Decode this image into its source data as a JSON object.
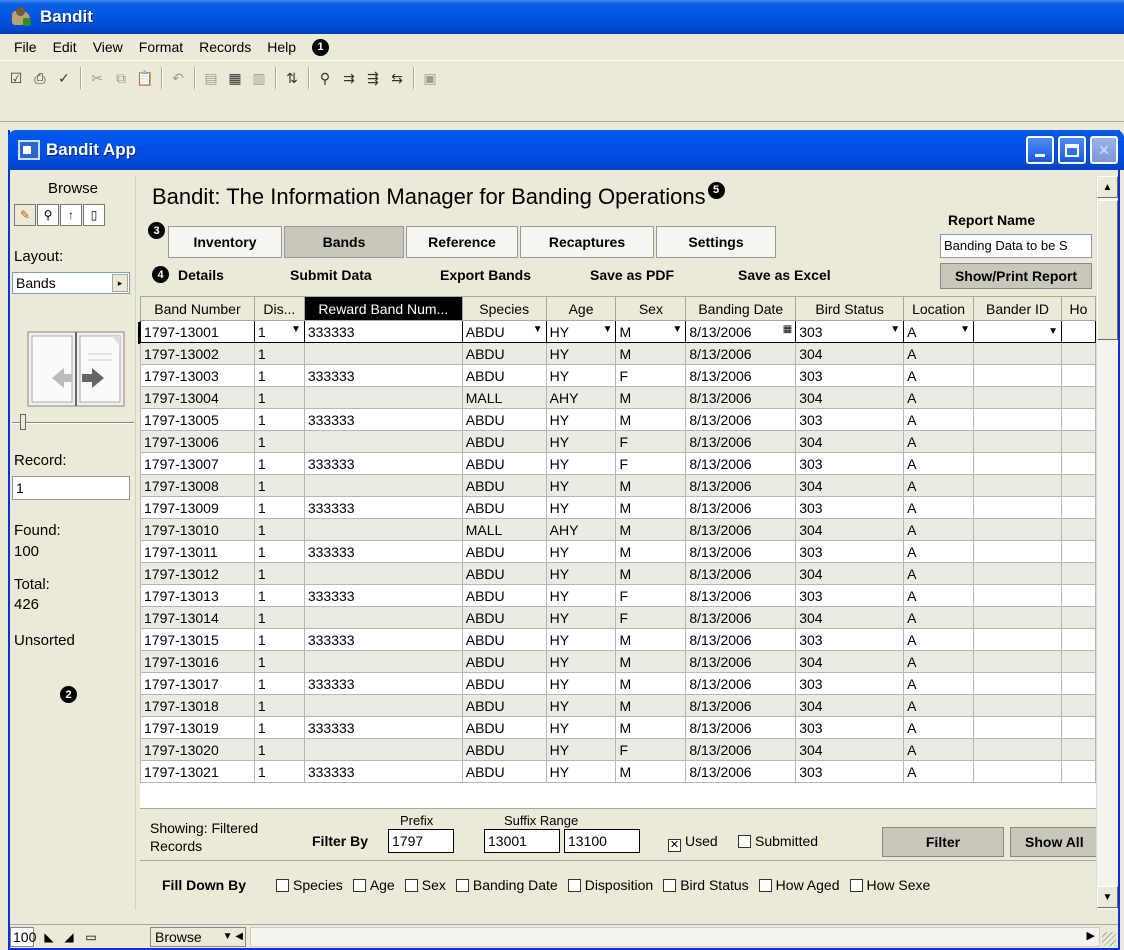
{
  "window": {
    "title": "Bandit",
    "inner_title": "Bandit App"
  },
  "menu": [
    "File",
    "Edit",
    "View",
    "Format",
    "Records",
    "Help"
  ],
  "markers": {
    "m1": "1",
    "m2": "2",
    "m3": "3",
    "m4": "4",
    "m5": "5"
  },
  "sidebar": {
    "mode_label": "Browse",
    "layout_label": "Layout:",
    "layout_value": "Bands",
    "record_label": "Record:",
    "record_value": "1",
    "found_label": "Found:",
    "found_value": "100",
    "total_label": "Total:",
    "total_value": "426",
    "sort_status": "Unsorted"
  },
  "header": {
    "title": "Bandit: The Information Manager for Banding Operations",
    "report_label": "Report Name",
    "report_value": "Banding Data to be S",
    "show_print": "Show/Print Report"
  },
  "tabs": [
    {
      "label": "Inventory"
    },
    {
      "label": "Bands"
    },
    {
      "label": "Reference"
    },
    {
      "label": "Recaptures"
    },
    {
      "label": "Settings"
    }
  ],
  "actions": [
    "Details",
    "Submit Data",
    "Export Bands",
    "Save as PDF",
    "Save as Excel"
  ],
  "columns": [
    "Band Number",
    "Dis...",
    "Reward Band Num...",
    "Species",
    "Age",
    "Sex",
    "Banding Date",
    "Bird Status",
    "Location",
    "Bander ID",
    "Ho"
  ],
  "rows": [
    [
      "1797-13001",
      "1",
      "333333",
      "ABDU",
      "HY",
      "M",
      "8/13/2006",
      "303",
      "A",
      "",
      ""
    ],
    [
      "1797-13002",
      "1",
      "",
      "ABDU",
      "HY",
      "M",
      "8/13/2006",
      "304",
      "A",
      "",
      ""
    ],
    [
      "1797-13003",
      "1",
      "333333",
      "ABDU",
      "HY",
      "F",
      "8/13/2006",
      "303",
      "A",
      "",
      ""
    ],
    [
      "1797-13004",
      "1",
      "",
      "MALL",
      "AHY",
      "M",
      "8/13/2006",
      "304",
      "A",
      "",
      ""
    ],
    [
      "1797-13005",
      "1",
      "333333",
      "ABDU",
      "HY",
      "M",
      "8/13/2006",
      "303",
      "A",
      "",
      ""
    ],
    [
      "1797-13006",
      "1",
      "",
      "ABDU",
      "HY",
      "F",
      "8/13/2006",
      "304",
      "A",
      "",
      ""
    ],
    [
      "1797-13007",
      "1",
      "333333",
      "ABDU",
      "HY",
      "F",
      "8/13/2006",
      "303",
      "A",
      "",
      ""
    ],
    [
      "1797-13008",
      "1",
      "",
      "ABDU",
      "HY",
      "M",
      "8/13/2006",
      "304",
      "A",
      "",
      ""
    ],
    [
      "1797-13009",
      "1",
      "333333",
      "ABDU",
      "HY",
      "M",
      "8/13/2006",
      "303",
      "A",
      "",
      ""
    ],
    [
      "1797-13010",
      "1",
      "",
      "MALL",
      "AHY",
      "M",
      "8/13/2006",
      "304",
      "A",
      "",
      ""
    ],
    [
      "1797-13011",
      "1",
      "333333",
      "ABDU",
      "HY",
      "M",
      "8/13/2006",
      "303",
      "A",
      "",
      ""
    ],
    [
      "1797-13012",
      "1",
      "",
      "ABDU",
      "HY",
      "M",
      "8/13/2006",
      "304",
      "A",
      "",
      ""
    ],
    [
      "1797-13013",
      "1",
      "333333",
      "ABDU",
      "HY",
      "F",
      "8/13/2006",
      "303",
      "A",
      "",
      ""
    ],
    [
      "1797-13014",
      "1",
      "",
      "ABDU",
      "HY",
      "F",
      "8/13/2006",
      "304",
      "A",
      "",
      ""
    ],
    [
      "1797-13015",
      "1",
      "333333",
      "ABDU",
      "HY",
      "M",
      "8/13/2006",
      "303",
      "A",
      "",
      ""
    ],
    [
      "1797-13016",
      "1",
      "",
      "ABDU",
      "HY",
      "M",
      "8/13/2006",
      "304",
      "A",
      "",
      ""
    ],
    [
      "1797-13017",
      "1",
      "333333",
      "ABDU",
      "HY",
      "M",
      "8/13/2006",
      "303",
      "A",
      "",
      ""
    ],
    [
      "1797-13018",
      "1",
      "",
      "ABDU",
      "HY",
      "M",
      "8/13/2006",
      "304",
      "A",
      "",
      ""
    ],
    [
      "1797-13019",
      "1",
      "333333",
      "ABDU",
      "HY",
      "M",
      "8/13/2006",
      "303",
      "A",
      "",
      ""
    ],
    [
      "1797-13020",
      "1",
      "",
      "ABDU",
      "HY",
      "F",
      "8/13/2006",
      "304",
      "A",
      "",
      ""
    ],
    [
      "1797-13021",
      "1",
      "333333",
      "ABDU",
      "HY",
      "M",
      "8/13/2006",
      "303",
      "A",
      "",
      ""
    ]
  ],
  "filter": {
    "showing": "Showing: Filtered Records",
    "by_label": "Filter By",
    "prefix_label": "Prefix",
    "prefix_value": "1797",
    "suffix_label": "Suffix Range",
    "suffix_from": "13001",
    "suffix_to": "13100",
    "used_label": "Used",
    "used_checked": true,
    "submitted_label": "Submitted",
    "filter_btn": "Filter",
    "show_all_btn": "Show All"
  },
  "filldown": {
    "label": "Fill Down By",
    "items": [
      "Species",
      "Age",
      "Sex",
      "Banding Date",
      "Disposition",
      "Bird Status",
      "How Aged",
      "How Sexe"
    ]
  },
  "status": {
    "zoom": "100",
    "mode": "Browse"
  }
}
